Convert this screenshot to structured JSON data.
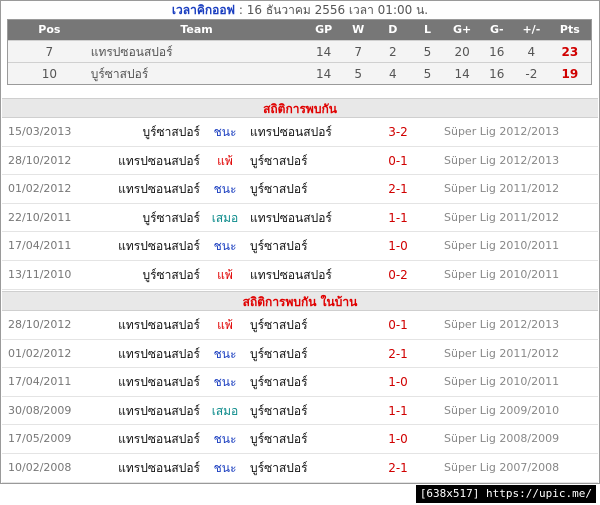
{
  "kickoff": {
    "label": "เวลาคิกออฟ",
    "text": ": 16 ธันวาคม 2556 เวลา 01:00 น."
  },
  "standings": {
    "headers": {
      "pos": "Pos",
      "team": "Team",
      "gp": "GP",
      "w": "W",
      "d": "D",
      "l": "L",
      "gf": "G+",
      "ga": "G-",
      "diff": "+/-",
      "pts": "Pts"
    },
    "rows": [
      {
        "pos": "7",
        "team": "แทรปซอนสปอร์",
        "gp": "14",
        "w": "7",
        "d": "2",
        "l": "5",
        "gf": "20",
        "ga": "16",
        "diff": "4",
        "pts": "23"
      },
      {
        "pos": "10",
        "team": "บูร์ซาสปอร์",
        "gp": "14",
        "w": "5",
        "d": "4",
        "l": "5",
        "gf": "14",
        "ga": "16",
        "diff": "-2",
        "pts": "19"
      }
    ]
  },
  "h2h": {
    "title": "สถิติการพบกัน",
    "rows": [
      {
        "date": "15/03/2013",
        "home": "บูร์ซาสปอร์",
        "result": "ชนะ",
        "type": "win",
        "away": "แทรปซอนสปอร์",
        "score": "3-2",
        "comp": "Süper Lig 2012/2013"
      },
      {
        "date": "28/10/2012",
        "home": "แทรปซอนสปอร์",
        "result": "แพ้",
        "type": "lose",
        "away": "บูร์ซาสปอร์",
        "score": "0-1",
        "comp": "Süper Lig 2012/2013"
      },
      {
        "date": "01/02/2012",
        "home": "แทรปซอนสปอร์",
        "result": "ชนะ",
        "type": "win",
        "away": "บูร์ซาสปอร์",
        "score": "2-1",
        "comp": "Süper Lig 2011/2012"
      },
      {
        "date": "22/10/2011",
        "home": "บูร์ซาสปอร์",
        "result": "เสมอ",
        "type": "draw",
        "away": "แทรปซอนสปอร์",
        "score": "1-1",
        "comp": "Süper Lig 2011/2012"
      },
      {
        "date": "17/04/2011",
        "home": "แทรปซอนสปอร์",
        "result": "ชนะ",
        "type": "win",
        "away": "บูร์ซาสปอร์",
        "score": "1-0",
        "comp": "Süper Lig 2010/2011"
      },
      {
        "date": "13/11/2010",
        "home": "บูร์ซาสปอร์",
        "result": "แพ้",
        "type": "lose",
        "away": "แทรปซอนสปอร์",
        "score": "0-2",
        "comp": "Süper Lig 2010/2011"
      }
    ]
  },
  "home_h2h": {
    "title": "สถิติการพบกัน ในบ้าน",
    "rows": [
      {
        "date": "28/10/2012",
        "home": "แทรปซอนสปอร์",
        "result": "แพ้",
        "type": "lose",
        "away": "บูร์ซาสปอร์",
        "score": "0-1",
        "comp": "Süper Lig 2012/2013"
      },
      {
        "date": "01/02/2012",
        "home": "แทรปซอนสปอร์",
        "result": "ชนะ",
        "type": "win",
        "away": "บูร์ซาสปอร์",
        "score": "2-1",
        "comp": "Süper Lig 2011/2012"
      },
      {
        "date": "17/04/2011",
        "home": "แทรปซอนสปอร์",
        "result": "ชนะ",
        "type": "win",
        "away": "บูร์ซาสปอร์",
        "score": "1-0",
        "comp": "Süper Lig 2010/2011"
      },
      {
        "date": "30/08/2009",
        "home": "แทรปซอนสปอร์",
        "result": "เสมอ",
        "type": "draw",
        "away": "บูร์ซาสปอร์",
        "score": "1-1",
        "comp": "Süper Lig 2009/2010"
      },
      {
        "date": "17/05/2009",
        "home": "แทรปซอนสปอร์",
        "result": "ชนะ",
        "type": "win",
        "away": "บูร์ซาสปอร์",
        "score": "1-0",
        "comp": "Süper Lig 2008/2009"
      },
      {
        "date": "10/02/2008",
        "home": "แทรปซอนสปอร์",
        "result": "ชนะ",
        "type": "win",
        "away": "บูร์ซาสปอร์",
        "score": "2-1",
        "comp": "Süper Lig 2007/2008"
      }
    ]
  },
  "watermark": "[638x517] https://upic.me/"
}
